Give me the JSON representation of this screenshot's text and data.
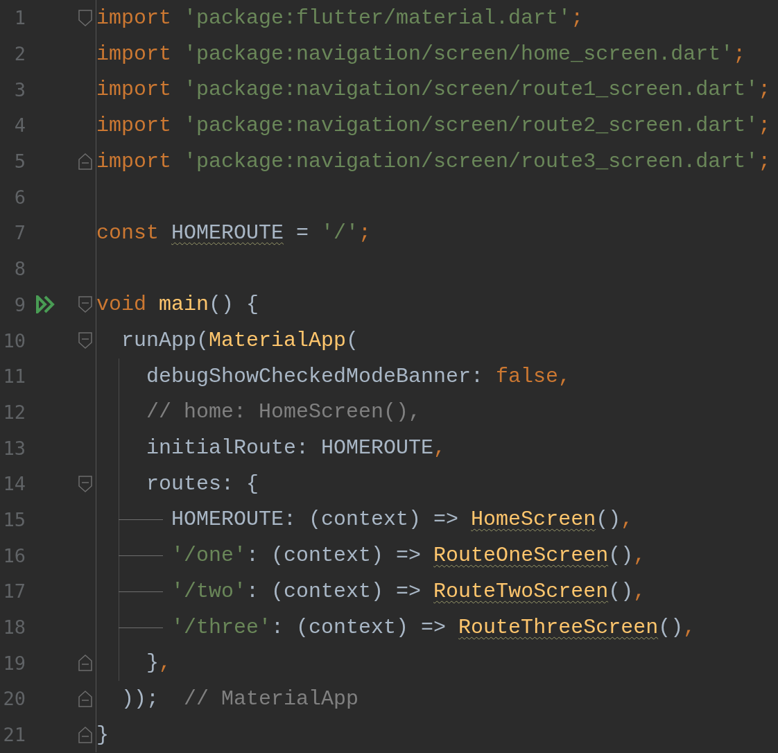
{
  "editor": {
    "lines": [
      {
        "number": "1",
        "fold_start": true,
        "tokens": [
          {
            "text": "import ",
            "kind": "keyword"
          },
          {
            "text": "'package:flutter/material.dart'",
            "kind": "string"
          },
          {
            "text": ";",
            "kind": "keyword"
          }
        ]
      },
      {
        "number": "2",
        "tokens": [
          {
            "text": "import ",
            "kind": "keyword"
          },
          {
            "text": "'package:navigation/screen/home_screen.dart'",
            "kind": "string"
          },
          {
            "text": ";",
            "kind": "keyword"
          }
        ]
      },
      {
        "number": "3",
        "tokens": [
          {
            "text": "import ",
            "kind": "keyword"
          },
          {
            "text": "'package:navigation/screen/route1_screen.dart'",
            "kind": "string"
          },
          {
            "text": ";",
            "kind": "keyword"
          }
        ]
      },
      {
        "number": "4",
        "tokens": [
          {
            "text": "import ",
            "kind": "keyword"
          },
          {
            "text": "'package:navigation/screen/route2_screen.dart'",
            "kind": "string"
          },
          {
            "text": ";",
            "kind": "keyword"
          }
        ]
      },
      {
        "number": "5",
        "fold_end": true,
        "tokens": [
          {
            "text": "import ",
            "kind": "keyword"
          },
          {
            "text": "'package:navigation/screen/route3_screen.dart'",
            "kind": "string"
          },
          {
            "text": ";",
            "kind": "keyword"
          }
        ]
      },
      {
        "number": "6"
      },
      {
        "number": "7",
        "tokens": [
          {
            "text": "const ",
            "kind": "keyword"
          },
          {
            "text": "HOMEROUTE",
            "kind": "plain",
            "warn": true
          },
          {
            "text": " = ",
            "kind": "plain"
          },
          {
            "text": "'/'",
            "kind": "string"
          },
          {
            "text": ";",
            "kind": "keyword"
          }
        ]
      },
      {
        "number": "8"
      },
      {
        "number": "9",
        "fold_start": true,
        "run": true,
        "tokens": [
          {
            "text": "void ",
            "kind": "keyword"
          },
          {
            "text": "main",
            "kind": "function"
          },
          {
            "text": "() {",
            "kind": "plain"
          }
        ]
      },
      {
        "number": "10",
        "fold_start": true,
        "tokens": [
          {
            "text": "  runApp(",
            "kind": "plain"
          },
          {
            "text": "MaterialApp",
            "kind": "function"
          },
          {
            "text": "(",
            "kind": "plain"
          }
        ]
      },
      {
        "number": "11",
        "guide": true,
        "tokens": [
          {
            "text": "    debugShowCheckedModeBanner: ",
            "kind": "plain"
          },
          {
            "text": "false,",
            "kind": "keyword"
          }
        ]
      },
      {
        "number": "12",
        "guide": true,
        "tokens": [
          {
            "text": "    // home: HomeScreen(),",
            "kind": "comment"
          }
        ]
      },
      {
        "number": "13",
        "guide": true,
        "tokens": [
          {
            "text": "    initialRoute: HOMEROUTE",
            "kind": "plain"
          },
          {
            "text": ",",
            "kind": "keyword"
          }
        ]
      },
      {
        "number": "14",
        "guide": true,
        "fold_start": true,
        "tokens": [
          {
            "text": "    routes: {",
            "kind": "plain"
          }
        ]
      },
      {
        "number": "15",
        "guide": true,
        "branch": true,
        "tokens": [
          {
            "text": "      HOMEROUTE: (context) => ",
            "kind": "plain"
          },
          {
            "text": "HomeScreen",
            "kind": "function",
            "warn": true
          },
          {
            "text": "()",
            "kind": "plain"
          },
          {
            "text": ",",
            "kind": "keyword"
          }
        ]
      },
      {
        "number": "16",
        "guide": true,
        "branch": true,
        "tokens": [
          {
            "text": "      '/one'",
            "kind": "string"
          },
          {
            "text": ": (context) => ",
            "kind": "plain"
          },
          {
            "text": "RouteOneScreen",
            "kind": "function",
            "warn": true
          },
          {
            "text": "()",
            "kind": "plain"
          },
          {
            "text": ",",
            "kind": "keyword"
          }
        ]
      },
      {
        "number": "17",
        "guide": true,
        "branch": true,
        "tokens": [
          {
            "text": "      '/two'",
            "kind": "string"
          },
          {
            "text": ": (context) => ",
            "kind": "plain"
          },
          {
            "text": "RouteTwoScreen",
            "kind": "function",
            "warn": true
          },
          {
            "text": "()",
            "kind": "plain"
          },
          {
            "text": ",",
            "kind": "keyword"
          }
        ]
      },
      {
        "number": "18",
        "guide": true,
        "branch": true,
        "tokens": [
          {
            "text": "      '/three'",
            "kind": "string"
          },
          {
            "text": ": (context) => ",
            "kind": "plain"
          },
          {
            "text": "RouteThreeScreen",
            "kind": "function",
            "warn": true
          },
          {
            "text": "()",
            "kind": "plain"
          },
          {
            "text": ",",
            "kind": "keyword"
          }
        ]
      },
      {
        "number": "19",
        "guide": true,
        "fold_end": true,
        "tokens": [
          {
            "text": "    }",
            "kind": "plain"
          },
          {
            "text": ",",
            "kind": "keyword"
          }
        ]
      },
      {
        "number": "20",
        "fold_end": true,
        "tokens": [
          {
            "text": "  ));",
            "kind": "plain"
          },
          {
            "text": "  // MaterialApp",
            "kind": "comment"
          }
        ]
      },
      {
        "number": "21",
        "fold_end": true,
        "tokens": [
          {
            "text": "}",
            "kind": "plain"
          }
        ]
      }
    ]
  }
}
